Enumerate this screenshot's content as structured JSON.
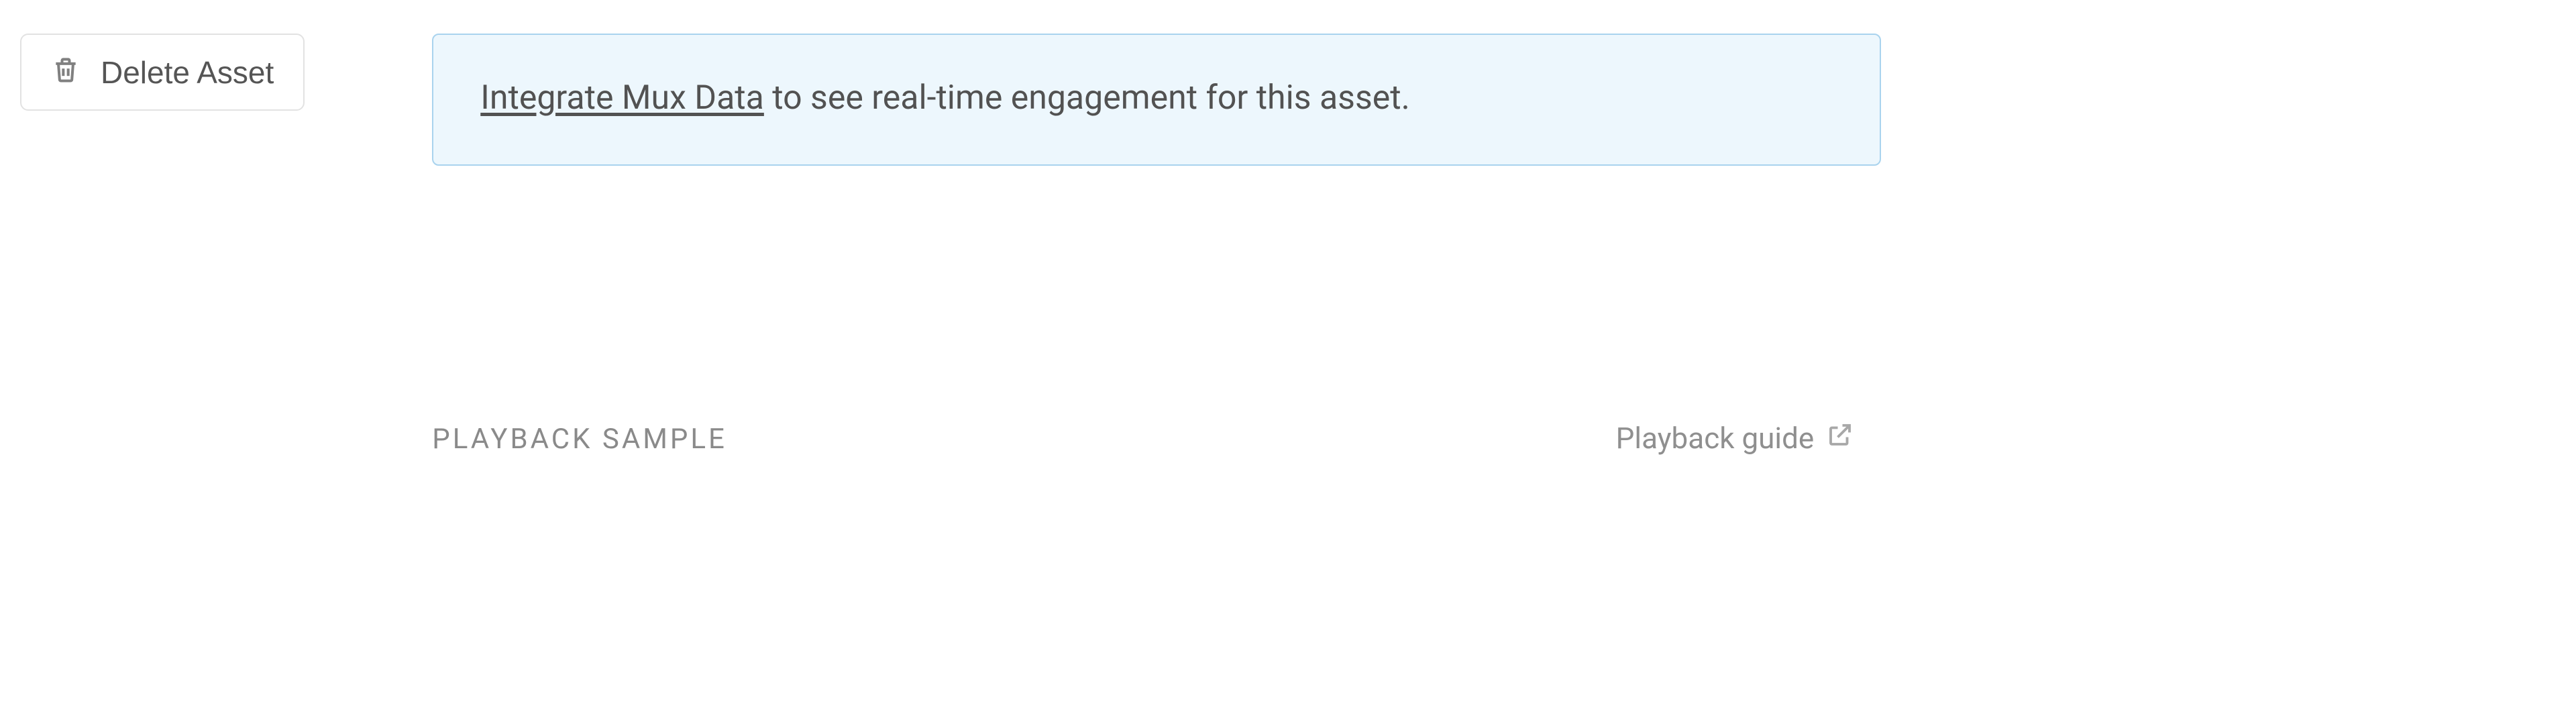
{
  "actions": {
    "delete_label": "Delete Asset"
  },
  "info_banner": {
    "link_text": "Integrate Mux Data",
    "tail_text": " to see real-time engagement for this asset."
  },
  "playback_section": {
    "heading": "PLAYBACK SAMPLE",
    "guide_label": "Playback guide"
  }
}
